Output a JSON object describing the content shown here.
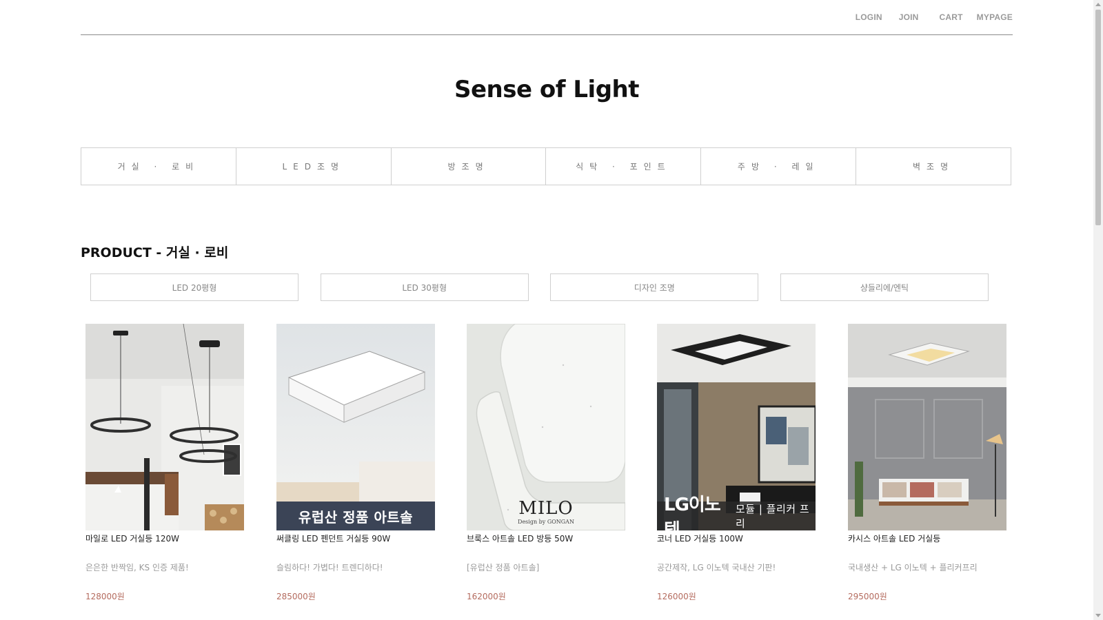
{
  "header": {
    "links": {
      "login": "LOGIN",
      "join": "JOIN",
      "cart": "CART",
      "mypage": "MYPAGE"
    },
    "site_title": "Sense of Light"
  },
  "category_nav": [
    "거실 · 로비",
    "LED조명",
    "방조명",
    "식탁 · 포인트",
    "주방 · 레일",
    "벽조명"
  ],
  "section": {
    "title": "PRODUCT - 거실 · 로비",
    "subcategories": [
      "LED 20평형",
      "LED 30평형",
      "디자인 조명",
      "샹들리에/엔틱"
    ]
  },
  "products": [
    {
      "name": "마일로 LED 거실등 120W",
      "desc": "은은한 반짝임, KS 인증 제품!",
      "price": "128000원"
    },
    {
      "name": "써클링 LED 펜던트 거실등 90W",
      "desc": "슬림하다! 가볍다! 트렌디하다!",
      "price": "285000원",
      "banner": "유럽산 정품 아트솔"
    },
    {
      "name": "브룩스 아트솔 LED 방등 50W",
      "desc": "[유럽산 정품 아트솔]",
      "price": "162000원",
      "brand": "MILO",
      "brand_sub": "Design by GONGAN"
    },
    {
      "name": "코너 LED 거실등 100W",
      "desc": "공간제작, LG 이노텍 국내산 기판!",
      "price": "126000원",
      "banner_big": "LG이노텍",
      "banner_small": "모듈 | 플리커 프리"
    },
    {
      "name": "카시스 아트솔 LED 거실등",
      "desc": "국내생산 + LG 이노텍 + 플리커프리",
      "price": "295000원"
    }
  ],
  "colors": {
    "price": "#b46b5e",
    "banner": "#3b4456",
    "divider": "#8a8a8a"
  }
}
